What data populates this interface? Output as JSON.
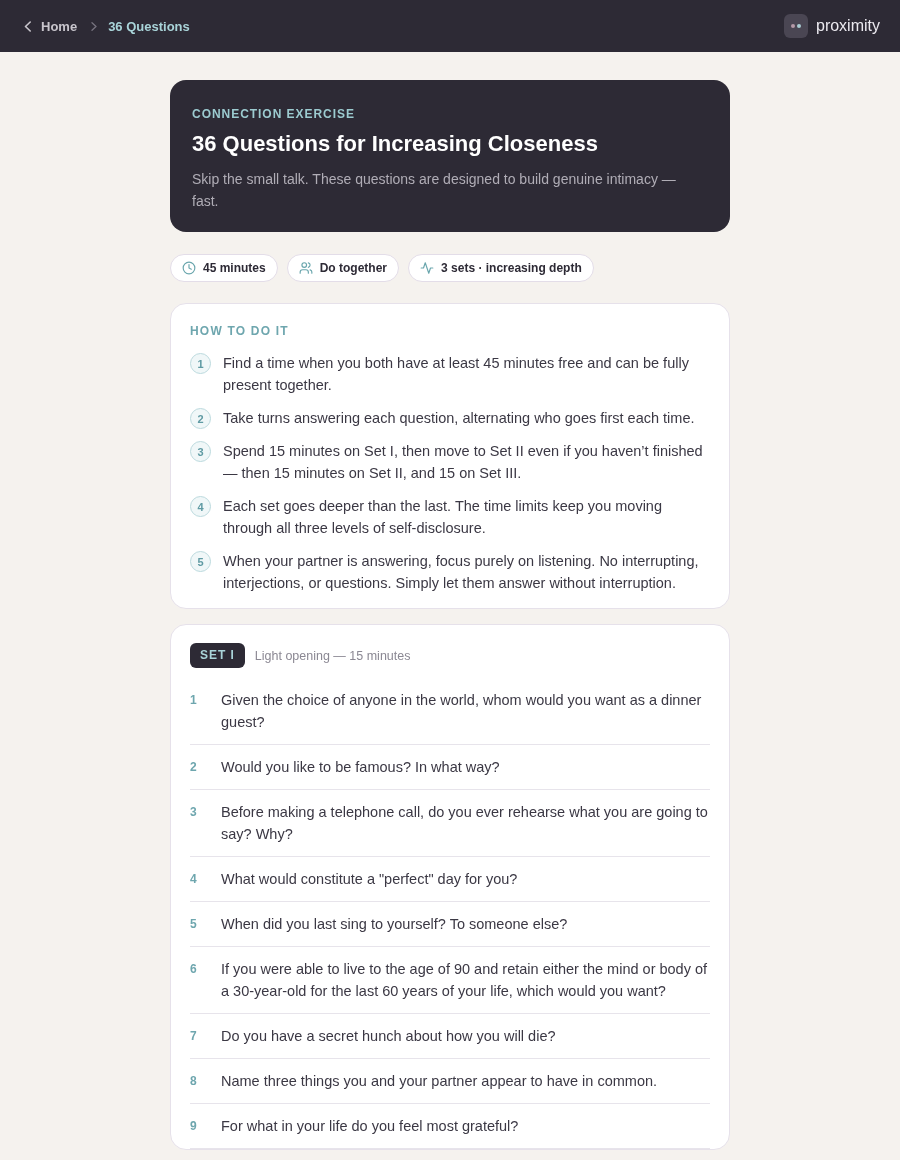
{
  "nav": {
    "back_label": "Home",
    "current": "36 Questions",
    "brand": "proximity"
  },
  "hero": {
    "eyebrow": "CONNECTION EXERCISE",
    "title": "36 Questions for Increasing Closeness",
    "subtitle": "Skip the small talk. These questions are designed to build genuine intimacy — fast."
  },
  "chips": [
    {
      "kind": "clock",
      "label": "45 minutes"
    },
    {
      "kind": "people",
      "label": "Do together"
    },
    {
      "kind": "pulse",
      "label": "3 sets · increasing depth"
    }
  ],
  "how_to": {
    "heading": "HOW TO DO IT",
    "steps": [
      {
        "number": "1",
        "text": "Find a time when you both have at least 45 minutes free and can be fully present together."
      },
      {
        "number": "2",
        "text": "Take turns answering each question, alternating who goes first each time."
      },
      {
        "number": "3",
        "text": "Spend 15 minutes on Set I, then move to Set II even if you haven’t finished — then 15 minutes on Set II, and 15 on Set III."
      },
      {
        "number": "4",
        "text": "Each set goes deeper than the last. The time limits keep you moving through all three levels of self-disclosure."
      },
      {
        "number": "5",
        "text": "When your partner is answering, focus purely on listening. No interrupting, interjections, or questions. Simply let them answer without interruption."
      }
    ]
  },
  "sets": [
    {
      "badge": "SET I",
      "subtitle": "Light opening — 15 minutes",
      "questions": [
        {
          "number": "1",
          "text": "Given the choice of anyone in the world, whom would you want as a dinner guest?"
        },
        {
          "number": "2",
          "text": "Would you like to be famous? In what way?"
        },
        {
          "number": "3",
          "text": "Before making a telephone call, do you ever rehearse what you are going to say? Why?"
        },
        {
          "number": "4",
          "text": "What would constitute a \"perfect\" day for you?"
        },
        {
          "number": "5",
          "text": "When did you last sing to yourself? To someone else?"
        },
        {
          "number": "6",
          "text": "If you were able to live to the age of 90 and retain either the mind or body of a 30-year-old for the last 60 years of your life, which would you want?"
        },
        {
          "number": "7",
          "text": "Do you have a secret hunch about how you will die?"
        },
        {
          "number": "8",
          "text": "Name three things you and your partner appear to have in common."
        },
        {
          "number": "9",
          "text": "For what in your life do you feel most grateful?"
        }
      ]
    }
  ]
}
